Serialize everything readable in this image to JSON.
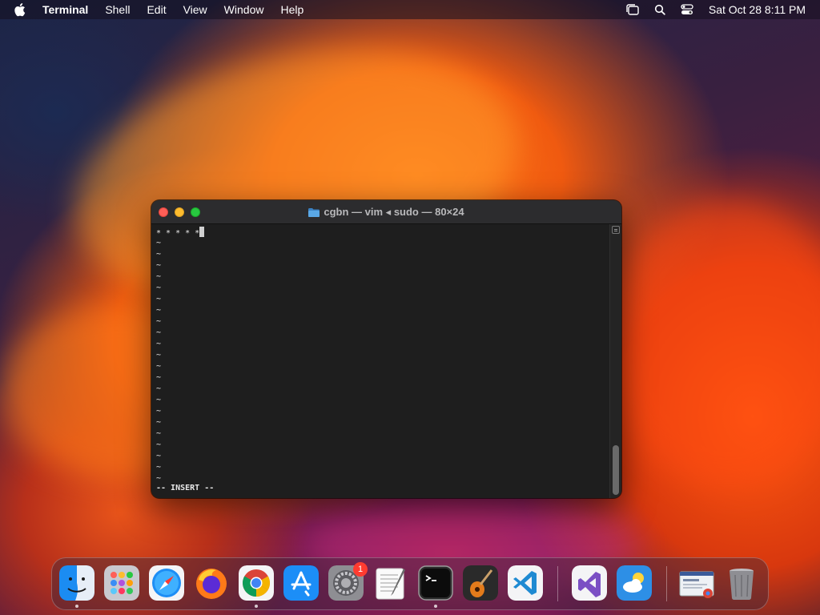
{
  "menubar": {
    "app_name": "Terminal",
    "items": [
      "Shell",
      "Edit",
      "View",
      "Window",
      "Help"
    ],
    "clock": "Sat Oct 28  8:11 PM",
    "status_icons": [
      "stage-manager-icon",
      "spotlight-search-icon",
      "control-center-icon"
    ]
  },
  "window": {
    "title": "cgbn — vim ◂ sudo — 80×24",
    "first_line": "* * * * *",
    "empty_line_marker": "~",
    "empty_line_count": 22,
    "mode_line": "-- INSERT --",
    "colors": {
      "close": "#ff5f57",
      "minimize": "#febc2e",
      "zoom": "#28c840"
    }
  },
  "dock": {
    "apps": [
      {
        "name": "finder-icon",
        "running": true
      },
      {
        "name": "launchpad-icon",
        "running": false
      },
      {
        "name": "safari-icon",
        "running": false
      },
      {
        "name": "firefox-icon",
        "running": false
      },
      {
        "name": "chrome-icon",
        "running": true
      },
      {
        "name": "app-store-icon",
        "running": false
      },
      {
        "name": "system-settings-icon",
        "running": false,
        "badge": "1"
      },
      {
        "name": "textedit-icon",
        "running": false
      },
      {
        "name": "terminal-icon",
        "running": true
      },
      {
        "name": "garageband-icon",
        "running": false
      },
      {
        "name": "vscode-icon",
        "running": false
      },
      {
        "name": "visual-studio-icon",
        "running": false
      },
      {
        "name": "weather-icon",
        "running": false
      },
      {
        "name": "chrome-window-icon",
        "running": false
      },
      {
        "name": "trash-icon",
        "running": false
      }
    ]
  }
}
